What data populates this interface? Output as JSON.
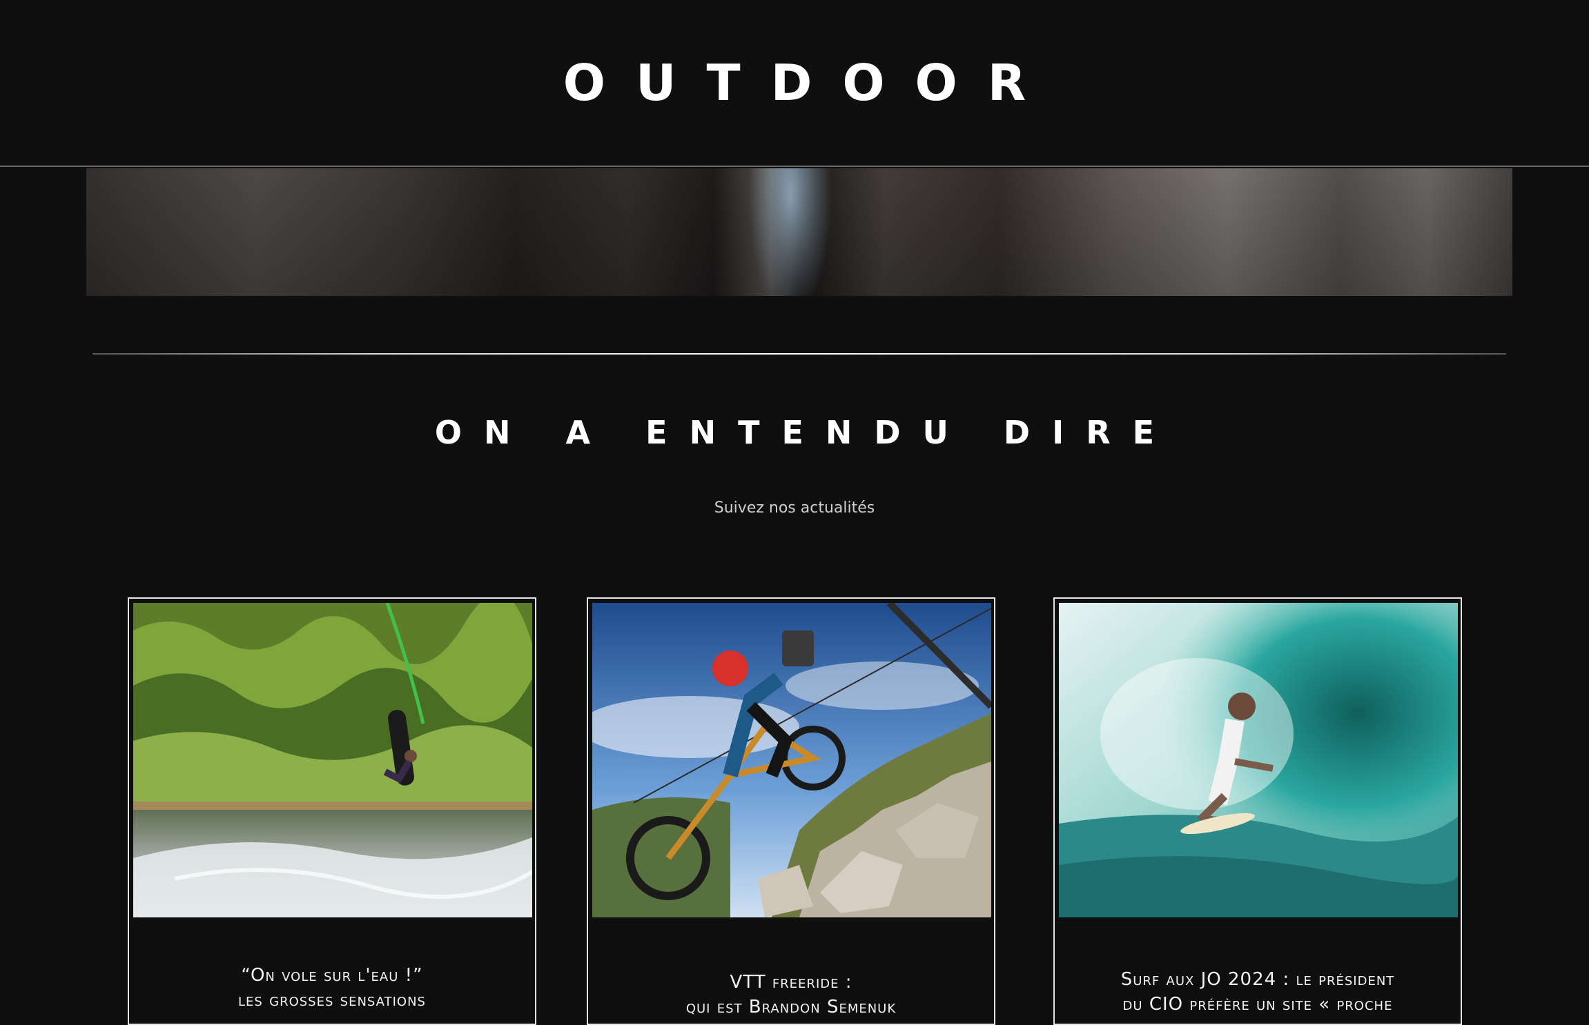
{
  "header": {
    "brand": "OUTDOOR"
  },
  "section": {
    "title": "ON A ENTENDU DIRE",
    "subtitle": "Suivez nos actualités"
  },
  "articles": [
    {
      "caption_line1": "“On vole sur l'eau !”",
      "caption_line2": "les grosses sensations",
      "photo": "wakeboard-jump"
    },
    {
      "caption_line1": "VTT freeride :",
      "caption_line2": "qui est Brandon Semenuk",
      "photo": "mountain-bike-downhill"
    },
    {
      "caption_line1": "Surf aux JO 2024 : le président",
      "caption_line2": "du CIO préfère un site « proche",
      "photo": "surfer-wave-barrel"
    }
  ]
}
